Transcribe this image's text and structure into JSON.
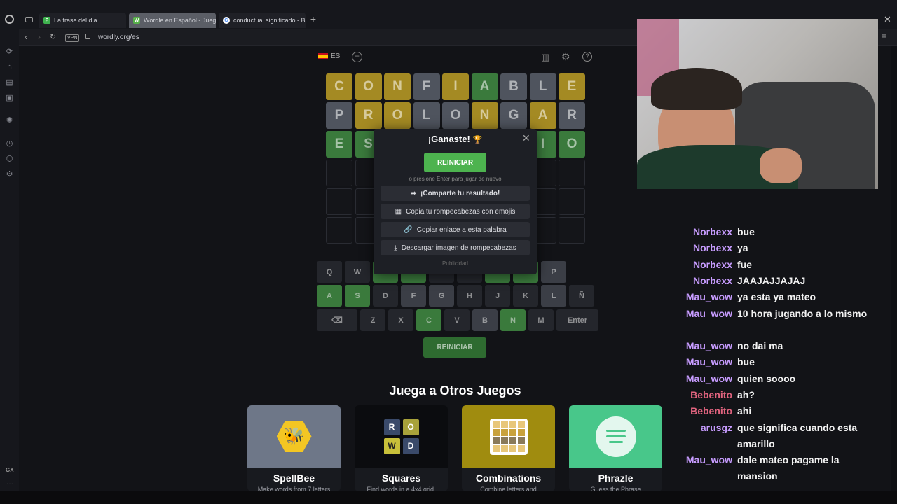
{
  "browser": {
    "tabs": [
      {
        "title": "La frase del dia",
        "icon": "P"
      },
      {
        "title": "Wordle en Español - Jueg",
        "icon": "W"
      },
      {
        "title": "conductual significado - B",
        "icon": "G"
      }
    ],
    "url": "wordly.org/es",
    "vpn_badge": "VPN",
    "gx_label": "GX"
  },
  "game": {
    "lang": "ES",
    "board": [
      [
        "C",
        "O",
        "N",
        "F",
        "I",
        "A",
        "B",
        "L",
        "E"
      ],
      [
        "P",
        "R",
        "O",
        "L",
        "O",
        "N",
        "G",
        "A",
        "R"
      ],
      [
        "E",
        "S",
        "",
        "",
        "",
        "",
        "",
        "I",
        "O"
      ]
    ],
    "board_states": [
      [
        "y",
        "y",
        "y",
        "x",
        "y",
        "g",
        "x",
        "x",
        "y"
      ],
      [
        "x",
        "y",
        "y",
        "x",
        "x",
        "y",
        "x",
        "y",
        "x"
      ],
      [
        "g",
        "g",
        "g",
        "g",
        "g",
        "g",
        "g",
        "g",
        "g"
      ]
    ],
    "keyboard": {
      "row1": [
        "Q",
        "W",
        "",
        "",
        "",
        "",
        "",
        "O",
        "P"
      ],
      "row2": [
        "A",
        "S",
        "D",
        "F",
        "G",
        "H",
        "J",
        "K",
        "L",
        "Ñ"
      ],
      "row3": [
        "⌫",
        "Z",
        "X",
        "C",
        "V",
        "B",
        "N",
        "M",
        "Enter"
      ]
    },
    "restart_label": "REINICIAR"
  },
  "modal": {
    "title": "¡Ganaste!",
    "trophy": "🏆",
    "restart_label": "REINICIAR",
    "hint": "o presione Enter para jugar de nuevo",
    "share_label": "¡Comparte tu resultado!",
    "emoji_label": "Copia tu rompecabezas con emojis",
    "link_label": "Copiar enlace a esta palabra",
    "download_label": "Descargar imagen de rompecabezas",
    "ad_label": "Publicidad"
  },
  "other_games": {
    "heading": "Juega a Otros Juegos",
    "cards": [
      {
        "title": "SpellBee",
        "desc": "Make words from 7 letters"
      },
      {
        "title": "Squares",
        "desc": "Find words in a 4x4 grid."
      },
      {
        "title": "Combinations",
        "desc": "Combine letters and"
      },
      {
        "title": "Phrazle",
        "desc": "Guess the Phrase"
      }
    ],
    "squares_letters": [
      "R",
      "O",
      "W",
      "D"
    ]
  },
  "chat": [
    {
      "user": "Norbexx",
      "msg": "bue",
      "color": "#c79cff"
    },
    {
      "user": "Norbexx",
      "msg": "ya",
      "color": "#c79cff"
    },
    {
      "user": "Norbexx",
      "msg": "fue",
      "color": "#c79cff"
    },
    {
      "user": "Norbexx",
      "msg": "JAAJAJJAJAJ",
      "color": "#c79cff"
    },
    {
      "user": "Mau_wow",
      "msg": "ya esta ya mateo",
      "color": "#c79cff"
    },
    {
      "user": "Mau_wow",
      "msg": "10 hora jugando a lo mismo",
      "color": "#c79cff"
    },
    {
      "user": "Mau_wow",
      "msg": "no dai ma",
      "color": "#c79cff"
    },
    {
      "user": "Mau_wow",
      "msg": "bue",
      "color": "#c79cff"
    },
    {
      "user": "Mau_wow",
      "msg": "quien soooo",
      "color": "#c79cff"
    },
    {
      "user": "Bebenito",
      "msg": "ah?",
      "color": "#e0637e"
    },
    {
      "user": "Bebenito",
      "msg": "ahi",
      "color": "#e0637e"
    },
    {
      "user": "arusgz",
      "msg": "que significa cuando esta amarillo",
      "color": "#c79cff"
    },
    {
      "user": "Mau_wow",
      "msg": "dale mateo pagame la mansion",
      "color": "#c79cff"
    }
  ]
}
